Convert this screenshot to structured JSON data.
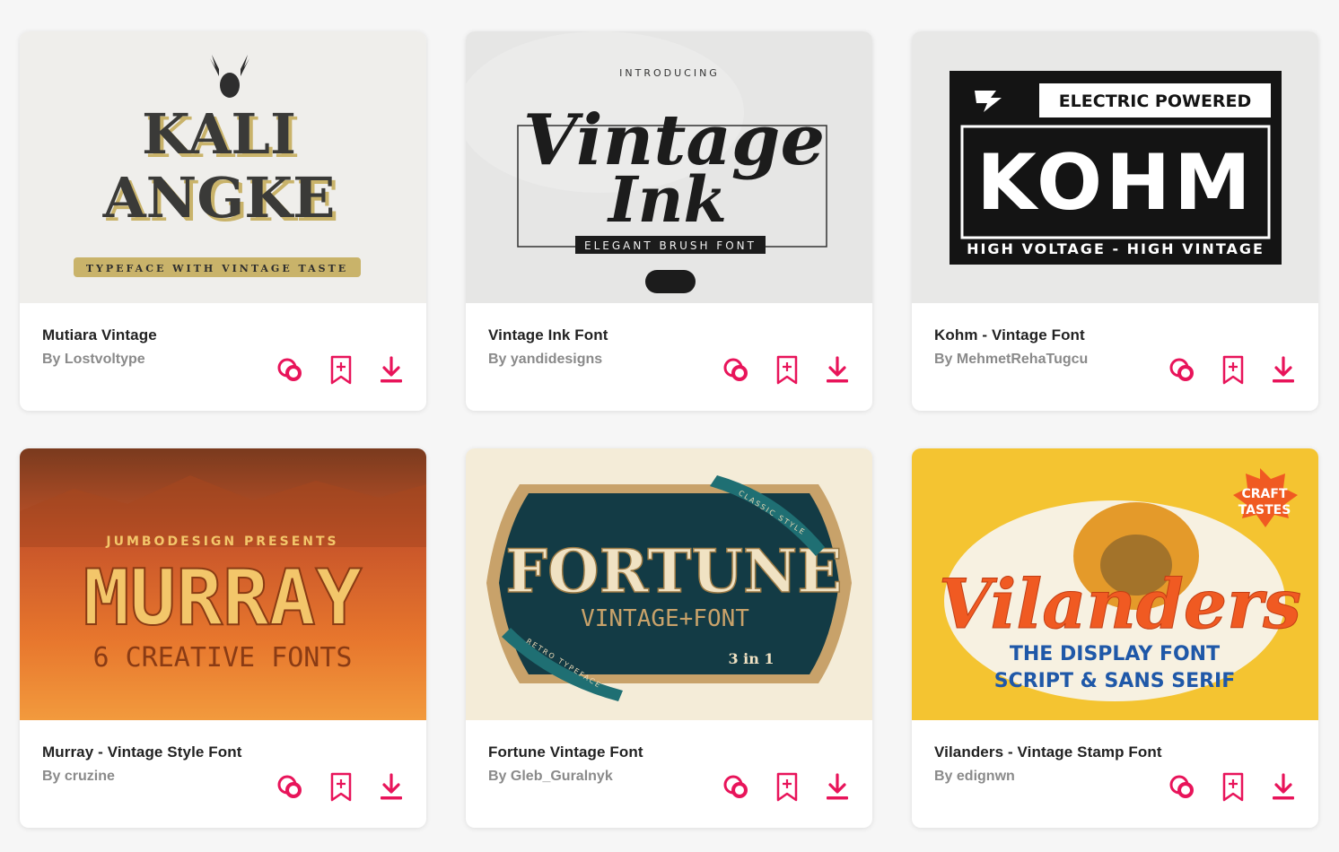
{
  "accent_color": "#e8145a",
  "cards": [
    {
      "title": "Mutiara Vintage",
      "author": "By Lostvoltype",
      "preview": {
        "line1": "KALI",
        "line2": "ANGKE",
        "ribbon": "TYPEFACE WITH VINTAGE TASTE"
      },
      "icons": [
        "overlap-circles-icon",
        "bookmark-add-icon",
        "download-icon"
      ]
    },
    {
      "title": "Vintage Ink Font",
      "author": "By yandidesigns",
      "preview": {
        "kicker": "INTRODUCING",
        "line1": "Vintage",
        "line2": "Ink",
        "ribbon": "ELEGANT BRUSH FONT"
      },
      "icons": [
        "overlap-circles-icon",
        "bookmark-add-icon",
        "download-icon"
      ]
    },
    {
      "title": "Kohm - Vintage Font",
      "author": "By MehmetRehaTugcu",
      "preview": {
        "badge": "ELECTRIC POWERED",
        "line1": "KOHM",
        "footer": "HIGH VOLTAGE - HIGH VINTAGE"
      },
      "icons": [
        "overlap-circles-icon",
        "bookmark-add-icon",
        "download-icon"
      ]
    },
    {
      "title": "Murray - Vintage Style Font",
      "author": "By cruzine",
      "preview": {
        "kicker": "JUMBODESIGN PRESENTS",
        "line1": "MURRAY",
        "line2": "6 CREATIVE FONTS"
      },
      "icons": [
        "overlap-circles-icon",
        "bookmark-add-icon",
        "download-icon"
      ]
    },
    {
      "title": "Fortune Vintage Font",
      "author": "By Gleb_Guralnyk",
      "preview": {
        "line1": "FORTUNE",
        "line2": "VINTAGE+FONT",
        "ribbon1": "CLASSIC STYLE",
        "ribbon2": "RETRO TYPEFACE",
        "badge": "3 in 1"
      },
      "icons": [
        "overlap-circles-icon",
        "bookmark-add-icon",
        "download-icon"
      ]
    },
    {
      "title": "Vilanders - Vintage Stamp Font",
      "author": "By edignwn",
      "preview": {
        "line1": "Vilanders",
        "line2": "THE DISPLAY FONT",
        "line3": "SCRIPT & SANS SERIF",
        "badge1": "CRAFT",
        "badge2": "TASTES"
      },
      "icons": [
        "overlap-circles-icon",
        "bookmark-add-icon",
        "download-icon"
      ]
    }
  ]
}
